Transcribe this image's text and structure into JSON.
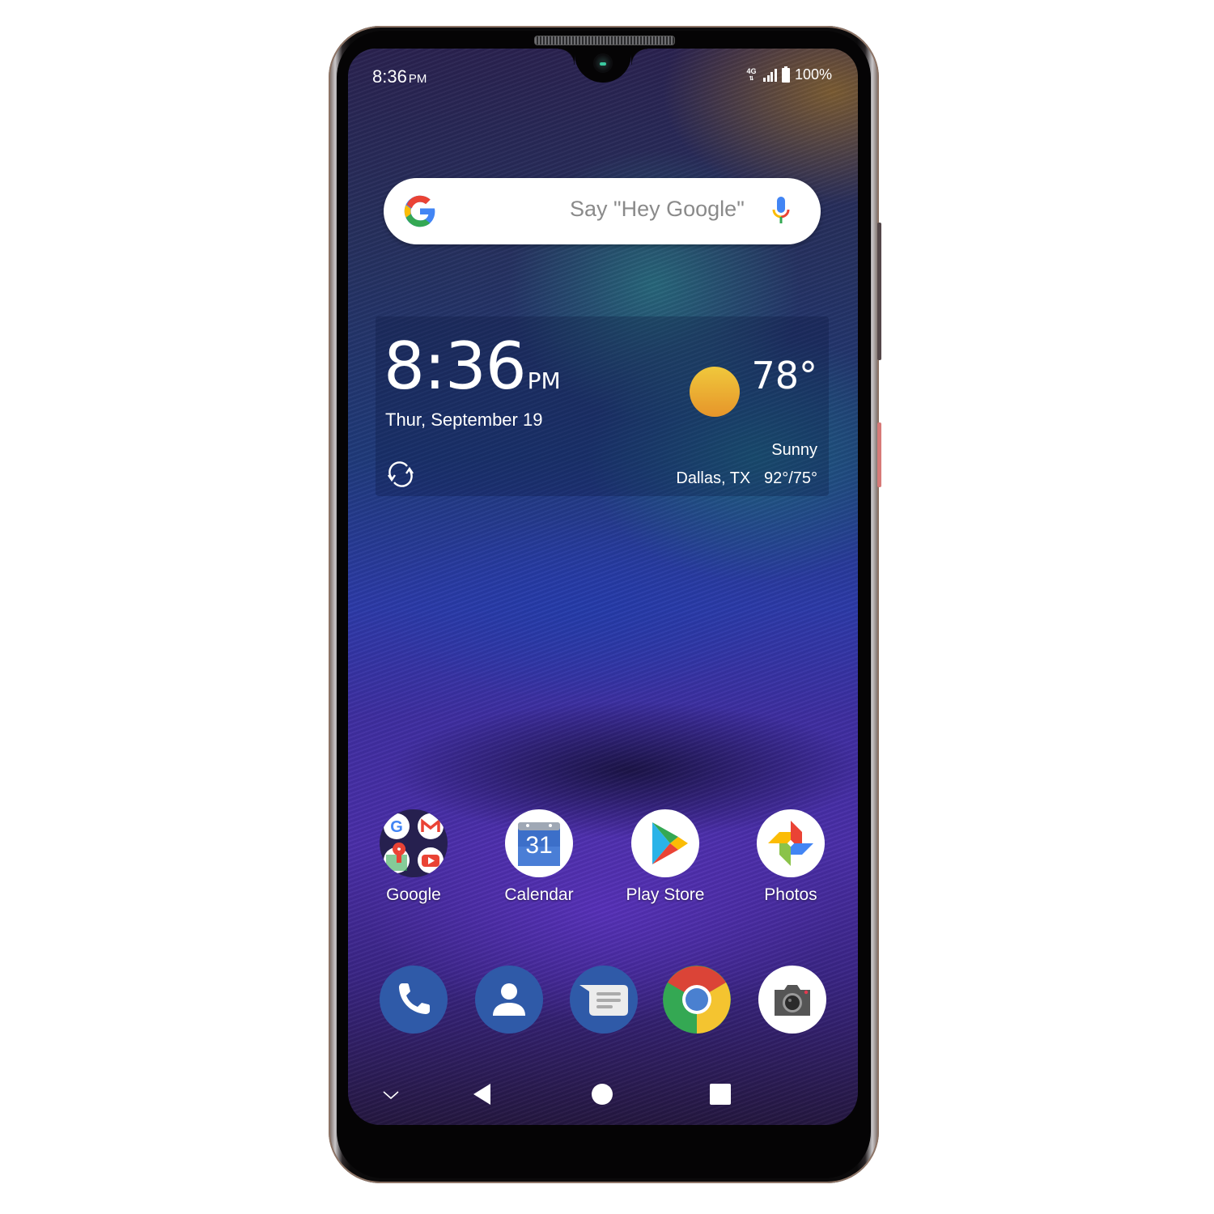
{
  "status_bar": {
    "time": "8:36",
    "ampm": "PM",
    "network": "4G",
    "network_sub": "LTE",
    "battery_percent": "100%",
    "signal_level": 4
  },
  "search": {
    "placeholder": "Say \"Hey Google\"",
    "icons": [
      "google-g-icon",
      "microphone-icon"
    ]
  },
  "clock_widget": {
    "time": "8:36",
    "ampm": "PM",
    "date": "Thur, September 19",
    "temperature": "78°",
    "condition": "Sunny",
    "location": "Dallas, TX",
    "high_low": "92°/75°",
    "weather_icon": "sun-icon",
    "refresh_icon": "refresh-icon"
  },
  "apps": [
    {
      "label": "Google",
      "icon": "google-folder-icon"
    },
    {
      "label": "Calendar",
      "icon": "calendar-icon",
      "badge_text": "31"
    },
    {
      "label": "Play Store",
      "icon": "play-store-icon"
    },
    {
      "label": "Photos",
      "icon": "photos-icon"
    }
  ],
  "dock": [
    {
      "name": "Phone",
      "icon": "phone-icon"
    },
    {
      "name": "Contacts",
      "icon": "contacts-icon"
    },
    {
      "name": "Messages",
      "icon": "messages-icon"
    },
    {
      "name": "Chrome",
      "icon": "chrome-icon"
    },
    {
      "name": "Camera",
      "icon": "camera-icon"
    }
  ],
  "nav_bar": {
    "items": [
      "hide-nav-chevron-icon",
      "back-icon",
      "home-icon",
      "recents-icon"
    ]
  },
  "colors": {
    "google_blue": "#4285F4",
    "google_red": "#EA4335",
    "google_yellow": "#FBBC05",
    "google_green": "#34A853",
    "dock_blue": "#2f5aa8",
    "sun_top": "#f0c83c",
    "sun_bottom": "#e6952a"
  }
}
